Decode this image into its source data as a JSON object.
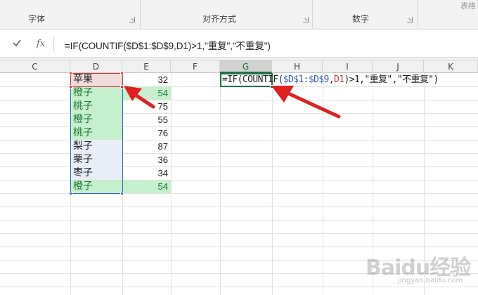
{
  "ribbon": {
    "groups": [
      {
        "label": "字体"
      },
      {
        "label": "对齐方式"
      },
      {
        "label": "数字"
      }
    ],
    "right_stub": "表格"
  },
  "formula_bar": {
    "confirm_icon": "check-icon",
    "fx_label": "fx",
    "formula": "=IF(COUNTIF($D$1:$D$9,D1)>1,\"重复\",\"不重复\")"
  },
  "columns": [
    "C",
    "D",
    "E",
    "F",
    "G",
    "H",
    "I",
    "J",
    "K"
  ],
  "active_column": "G",
  "rows": [
    {
      "d": "苹果",
      "e": "32"
    },
    {
      "d": "橙子",
      "e": "54"
    },
    {
      "d": "桃子",
      "e": "75"
    },
    {
      "d": "橙子",
      "e": "55"
    },
    {
      "d": "桃子",
      "e": "76"
    },
    {
      "d": "梨子",
      "e": "87"
    },
    {
      "d": "栗子",
      "e": "36"
    },
    {
      "d": "枣子",
      "e": "34"
    },
    {
      "d": "橙子",
      "e": "54"
    }
  ],
  "g_formula": {
    "p1": "=IF(COUNTIF(",
    "p2": "$D$1:$D$9",
    "p3": ",",
    "p4": "D1",
    "p5": ")>1,\"重复\",\"不重复\")"
  },
  "colors": {
    "duplicate_fill": "#c6efce",
    "duplicate_text": "#1a7a2c",
    "first_row_fill": "#f2dcdb",
    "selection_border": "#2f67c0",
    "active_border": "#217346",
    "arrow_red": "#e02020"
  },
  "watermark": {
    "text": "Baidu经验",
    "sub": "jingyan.baidu.com"
  }
}
